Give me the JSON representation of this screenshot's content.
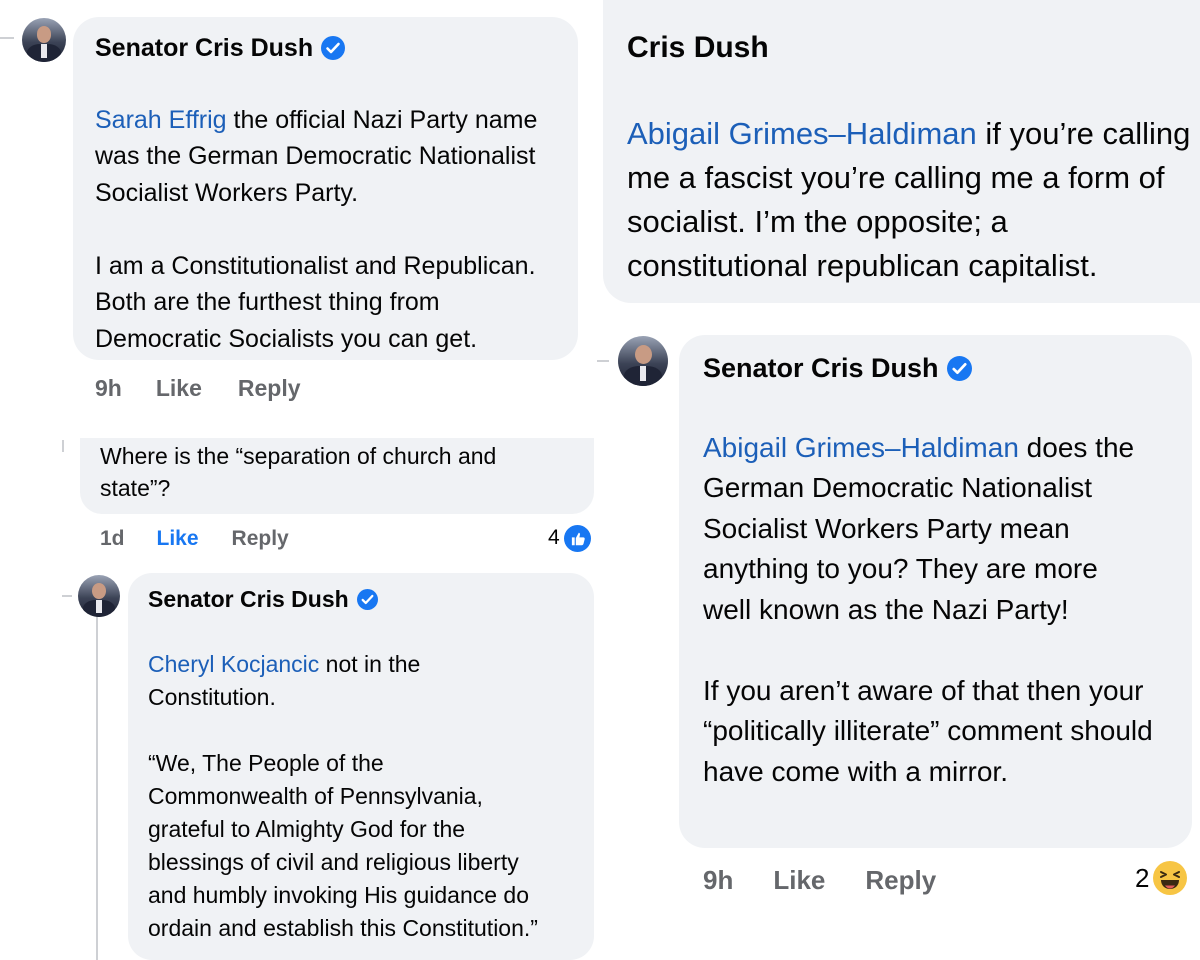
{
  "comment1": {
    "author": "Senator Cris Dush",
    "mention": "Sarah Effrig",
    "text": " the official Nazi Party name was the German Democratic Nationalist Socialist Workers Party.\n\nI am a Constitutionalist and Republican.  Both are the furthest thing from Democratic Socialists you can get.",
    "time": "9h",
    "like": "Like",
    "reply": "Reply"
  },
  "comment2": {
    "text": "Where is the “separation of church and state”?",
    "time": "1d",
    "like": "Like",
    "reply": "Reply",
    "reaction_count": "4",
    "reaction_icon": "like-reaction-icon"
  },
  "comment3": {
    "author": "Senator Cris Dush",
    "mention": "Cheryl Kocjancic",
    "text": " not in the Constitution.\n\n“We, The People of the Commonwealth of Pennsylvania, grateful to Almighty God for the blessings of civil and religious liberty and humbly invoking His guidance do ordain and establish this Constitution.”"
  },
  "comment4": {
    "author": "Cris Dush",
    "mention": "Abigail Grimes–Haldiman",
    "text": " if you’re calling me a fascist you’re calling me a form of socialist.  I’m the opposite; a constitutional republican capitalist."
  },
  "comment5": {
    "author": "Senator Cris Dush",
    "mention": "Abigail Grimes–Haldiman",
    "text": " does the German Democratic Nationalist Socialist Workers Party mean anything to you? They are more well known as the Nazi Party!\n\nIf you aren’t aware of that then your “politically illiterate” comment should have come with a mirror.",
    "time": "9h",
    "like": "Like",
    "reply": "Reply",
    "reaction_count": "2",
    "reaction_icon": "haha-reaction-icon"
  },
  "colors": {
    "bubble": "#f0f2f5",
    "mention": "#1c5fb8",
    "verified": "#1877f2",
    "meta": "#65676b"
  }
}
